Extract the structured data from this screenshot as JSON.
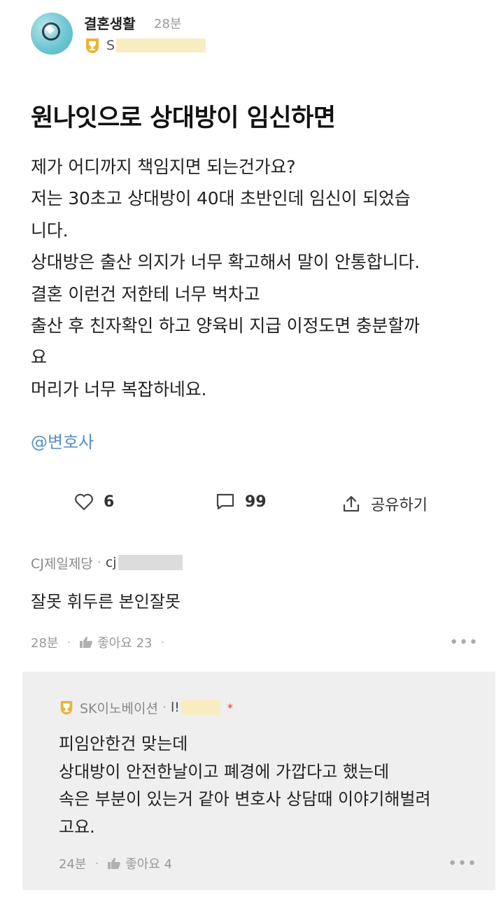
{
  "post": {
    "board": "결혼생활",
    "time": "28분",
    "author_prefix": "S",
    "title": "원나잇으로 상대방이 임신하면",
    "body_lines": [
      "제가 어디까지 책임지면 되는건가요?",
      "저는 30초고 상대방이 40대 초반인데 임신이 되었습",
      "니다.",
      "상대방은 출산 의지가 너무 확고해서 말이 안통합니다.",
      "결혼 이런건 저한테 너무 벅차고",
      "출산 후 친자확인 하고 양육비 지급 이정도면 충분할까",
      "요",
      "머리가 너무 복잡하네요."
    ],
    "mention": "@변호사"
  },
  "actions": {
    "likes": "6",
    "comments": "99",
    "share_label": "공유하기"
  },
  "comment": {
    "company": "CJ제일제당",
    "dot": "·",
    "handle_prefix": "cj",
    "text": "잘못 휘두른 본인잘못",
    "time": "28분",
    "like_label": "좋아요 23",
    "sep": "·",
    "more": "•••"
  },
  "reply": {
    "company": "SK이노베이션",
    "dot": "·",
    "handle_prefix": "l!",
    "star": "*",
    "body_lines": [
      "피임안한건 맞는데",
      "상대방이 안전한날이고 폐경에 가깝다고 했는데",
      "속은 부분이 있는거 같아 변호사 상담때 이야기해벌려",
      "고요."
    ],
    "time": "24분",
    "like_label": "좋아요 4",
    "sep": "·",
    "more": "•••"
  },
  "colors": {
    "mention": "#5a8fc7",
    "reply_background": "#efefef",
    "redaction": "#f8edc0",
    "badge": "#e8b43a",
    "star": "#e0342c"
  },
  "icons": [
    "ring-avatar-icon",
    "trophy-badge-icon",
    "heart-icon",
    "comment-icon",
    "share-icon",
    "thumbs-up-icon",
    "more-dots-icon"
  ]
}
